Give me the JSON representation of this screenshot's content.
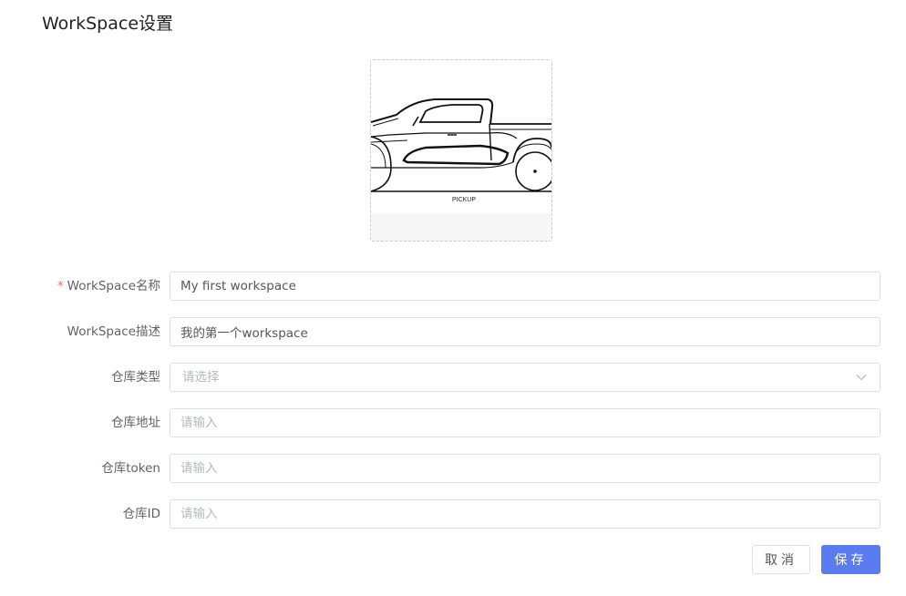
{
  "page": {
    "title": "WorkSpace设置"
  },
  "uploader": {
    "image_caption": "PICKUP"
  },
  "form": {
    "name": {
      "label": "WorkSpace名称",
      "required_mark": "*",
      "value": "My first workspace"
    },
    "description": {
      "label": "WorkSpace描述",
      "value": "我的第一个workspace"
    },
    "repo_type": {
      "label": "仓库类型",
      "placeholder": "请选择"
    },
    "repo_address": {
      "label": "仓库地址",
      "placeholder": "请输入"
    },
    "repo_token": {
      "label": "仓库token",
      "placeholder": "请输入"
    },
    "repo_id": {
      "label": "仓库ID",
      "placeholder": "请输入"
    }
  },
  "actions": {
    "cancel_label": "取消",
    "save_label": "保存"
  },
  "colors": {
    "primary": "#5b7cf0",
    "required": "#f56c6c",
    "border": "#dcdfe6"
  }
}
